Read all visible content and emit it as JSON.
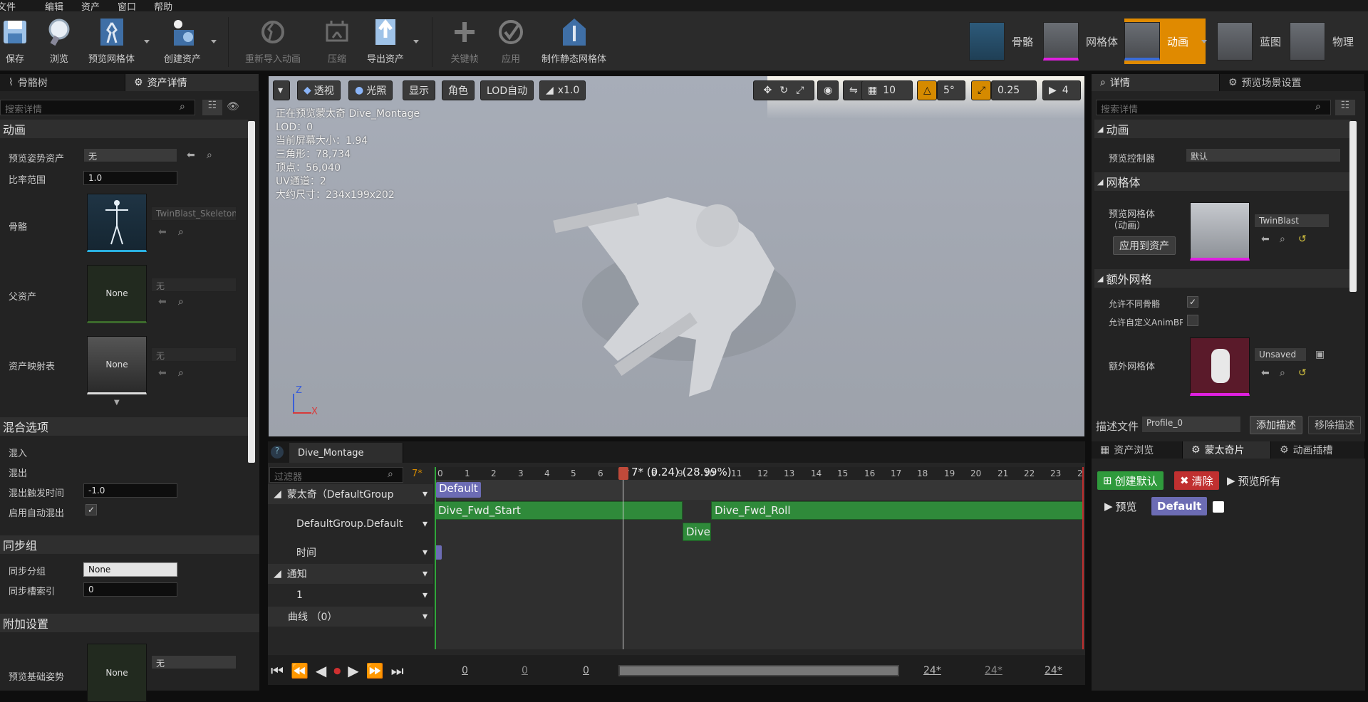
{
  "menu": [
    "文件",
    "编辑",
    "资产",
    "窗口",
    "帮助"
  ],
  "toolbar": {
    "save": "保存",
    "browse": "浏览",
    "preview_mesh": "预览网格体",
    "create_asset": "创建资产",
    "reimport": "重新导入动画",
    "compress": "压缩",
    "export": "导出资产",
    "keyframe": "关键帧",
    "apply": "应用",
    "make_static": "制作静态网格体"
  },
  "modes": {
    "skeleton": "骨骼",
    "mesh": "网格体",
    "animation": "动画",
    "blueprint": "蓝图",
    "physics": "物理"
  },
  "left": {
    "tabs": [
      "骨骼树",
      "资产详情"
    ],
    "search_placeholder": "搜索详情",
    "sec_anim": "动画",
    "preview_pose_label": "预览姿势资产",
    "preview_pose_value": "无",
    "rate_label": "比率范围",
    "rate_value": "1.0",
    "skeleton_label": "骨骼",
    "skeleton_value": "TwinBlast_Skeleton",
    "parent_label": "父资产",
    "parent_thumb": "None",
    "parent_value": "无",
    "map_label": "资产映射表",
    "map_thumb": "None",
    "map_value": "无",
    "sec_blend": "混合选项",
    "blend_in": "混入",
    "blend_out": "混出",
    "blend_trigger_label": "混出触发时间",
    "blend_trigger_value": "-1.0",
    "auto_blend_label": "启用自动混出",
    "sec_sync": "同步组",
    "sync_group_label": "同步分组",
    "sync_group_value": "None",
    "sync_index_label": "同步槽索引",
    "sync_index_value": "0",
    "sec_add": "附加设置",
    "base_pose_label": "预览基础姿势",
    "base_pose_thumb": "None",
    "base_pose_value": "无"
  },
  "viewport": {
    "perspective": "透视",
    "lit": "光照",
    "show": "显示",
    "character": "角色",
    "lod": "LOD自动",
    "speed": "x1.0",
    "grid": "10",
    "angle": "5°",
    "scale": "0.25",
    "cam_speed": "4",
    "stats": [
      "正在预览蒙太奇 Dive_Montage",
      "LOD：0",
      "当前屏幕大小：1.94",
      "三角形：78,734",
      "顶点：56,040",
      "UV通道：2",
      "大约尺寸：234x199x202"
    ],
    "axis_z": "Z",
    "axis_x": "X"
  },
  "seq": {
    "tab": "Dive_Montage",
    "filter": "过滤器",
    "frame_marker": "7*",
    "playhead": "7* (0.24) (28.99%)",
    "tracks": [
      "蒙太奇（DefaultGroup",
      "DefaultGroup.Default",
      "时间",
      "通知",
      "1",
      "曲线 （0）"
    ],
    "ruler": [
      "0",
      "1",
      "2",
      "3",
      "4",
      "5",
      "6",
      "7",
      "8",
      "9",
      "10",
      "11",
      "12",
      "13",
      "14",
      "15",
      "16",
      "17",
      "18",
      "19",
      "20",
      "21",
      "22",
      "23",
      "2"
    ],
    "default_section": "Default",
    "seg1": "Dive_Fwd_Start",
    "seg2": "Dive_Fwd_Roll",
    "seg3": "Dive",
    "bottom": [
      "0",
      "0",
      "0",
      "24*",
      "24*",
      "24*"
    ]
  },
  "right": {
    "tabs": [
      "详情",
      "预览场景设置"
    ],
    "search_placeholder": "搜索详情",
    "sec_anim": "动画",
    "controller_label": "预览控制器",
    "controller_value": "默认",
    "sec_mesh": "网格体",
    "preview_mesh_label": "预览网格体（动画）",
    "preview_mesh_value": "TwinBlast",
    "apply_btn": "应用到资产",
    "sec_extra": "额外网格",
    "allow_diff_label": "允许不同骨骼",
    "allow_custom_label": "允许自定义AnimBP",
    "extra_mesh_label": "额外网格体",
    "extra_mesh_value": "Unsaved",
    "profile_label": "描述文件",
    "profile_value": "Profile_0",
    "add_profile": "添加描述",
    "remove_profile": "移除描述",
    "tabs2": [
      "资产浏览",
      "蒙太奇片",
      "动画插槽"
    ],
    "create_default": "创建默认",
    "clear": "清除",
    "preview_all": "预览所有",
    "preview": "预览",
    "default_chip": "Default"
  }
}
